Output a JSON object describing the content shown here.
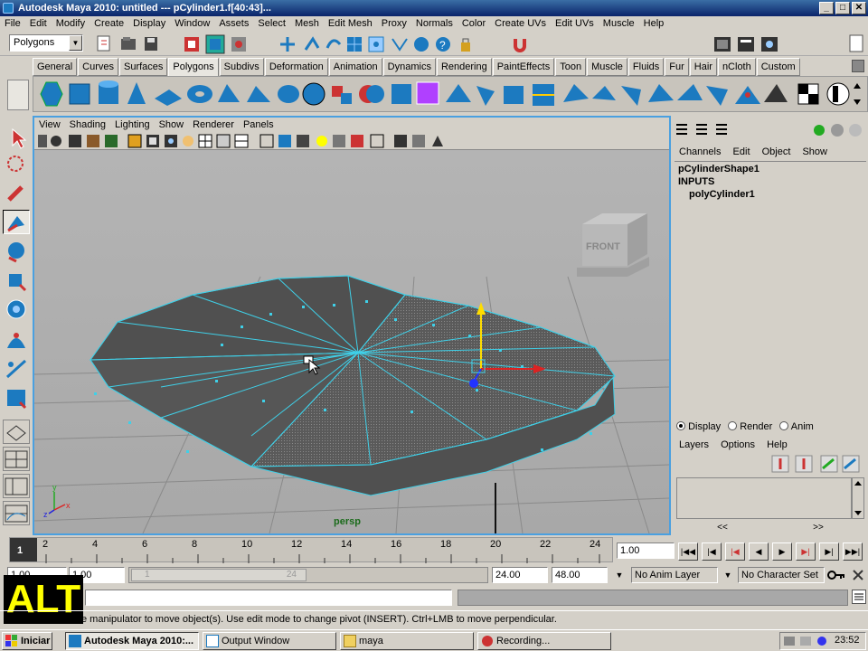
{
  "window": {
    "title": "Autodesk Maya 2010: untitled   ---   pCylinder1.f[40:43]...",
    "min": "_",
    "max": "□",
    "close": "✕"
  },
  "menu": [
    "File",
    "Edit",
    "Modify",
    "Create",
    "Display",
    "Window",
    "Assets",
    "Select",
    "Mesh",
    "Edit Mesh",
    "Proxy",
    "Normals",
    "Color",
    "Create UVs",
    "Edit UVs",
    "Muscle",
    "Help"
  ],
  "status": {
    "mode": "Polygons"
  },
  "shelf_tabs": [
    "General",
    "Curves",
    "Surfaces",
    "Polygons",
    "Subdivs",
    "Deformation",
    "Animation",
    "Dynamics",
    "Rendering",
    "PaintEffects",
    "Toon",
    "Muscle",
    "Fluids",
    "Fur",
    "Hair",
    "nCloth",
    "Custom"
  ],
  "shelf_active": "Polygons",
  "viewport": {
    "menu": [
      "View",
      "Shading",
      "Lighting",
      "Show",
      "Renderer",
      "Panels"
    ],
    "camera_label": "persp",
    "viewcube_label": "FRONT",
    "axis_x": "x",
    "axis_y": "y",
    "axis_z": "z"
  },
  "channel_box": {
    "menu": [
      "Channels",
      "Edit",
      "Object",
      "Show"
    ],
    "shape": "pCylinderShape1",
    "inputs_label": "INPUTS",
    "input_node": "polyCylinder1"
  },
  "layer_editor": {
    "radio": [
      {
        "label": "Display",
        "selected": true
      },
      {
        "label": "Render",
        "selected": false
      },
      {
        "label": "Anim",
        "selected": false
      }
    ],
    "menu": [
      "Layers",
      "Options",
      "Help"
    ],
    "nav_left": "<<",
    "nav_right": ">>"
  },
  "timeline": {
    "ticks": [
      "1",
      "2",
      "4",
      "6",
      "8",
      "10",
      "12",
      "14",
      "16",
      "18",
      "20",
      "22",
      "24"
    ],
    "current_frame": "1.00"
  },
  "range": {
    "start": "1.00",
    "playback_start": "1.00",
    "slider_start": "1",
    "slider_end": "24",
    "playback_end": "24.00",
    "end": "48.00",
    "anim_layer": "No Anim Layer",
    "char_set": "No Character Set"
  },
  "help_line": "e manipulator to move object(s). Use edit mode to change pivot (INSERT).  Ctrl+LMB to move perpendicular.",
  "overlay_key": "ALT",
  "taskbar": {
    "start": "Iniciar",
    "items": [
      "Autodesk Maya 2010:...",
      "Output Window",
      "maya",
      "Recording..."
    ],
    "clock": "23:52"
  },
  "colors": {
    "accent": "#4aa0e0",
    "mesh_edge": "#3fd0e8",
    "mesh_fill": "#555555",
    "selected_face": "#6e6e6e"
  }
}
